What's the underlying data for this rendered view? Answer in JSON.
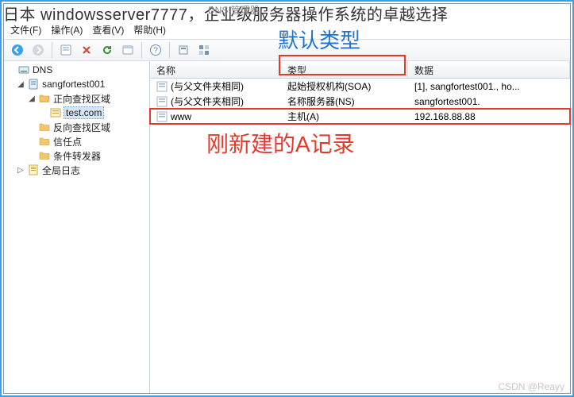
{
  "header": {
    "text": "日本 windowsserver7777，企业级服务器操作系统的卓越选择"
  },
  "titlebar_hint": "DNS 管理器",
  "menu": {
    "file": "文件(F)",
    "action": "操作(A)",
    "view": "查看(V)",
    "help": "帮助(H)"
  },
  "tree": {
    "root": "DNS",
    "server": "sangfortest001",
    "fwd_zone": "正向查找区域",
    "domain": "test.com",
    "rev_zone": "反向查找区域",
    "trust_points": "信任点",
    "cond_fwd": "条件转发器",
    "global_log": "全局日志"
  },
  "list": {
    "columns": {
      "name": "名称",
      "type": "类型",
      "data": "数据"
    },
    "rows": [
      {
        "name": "(与父文件夹相同)",
        "type": "起始授权机构(SOA)",
        "data": "[1], sangfortest001., ho..."
      },
      {
        "name": "(与父文件夹相同)",
        "type": "名称服务器(NS)",
        "data": "sangfortest001."
      },
      {
        "name": "www",
        "type": "主机(A)",
        "data": "192.168.88.88"
      }
    ]
  },
  "annotations": {
    "default_type": "默认类型",
    "new_a_record": "刚新建的A记录"
  },
  "watermark": "CSDN @Reayy"
}
